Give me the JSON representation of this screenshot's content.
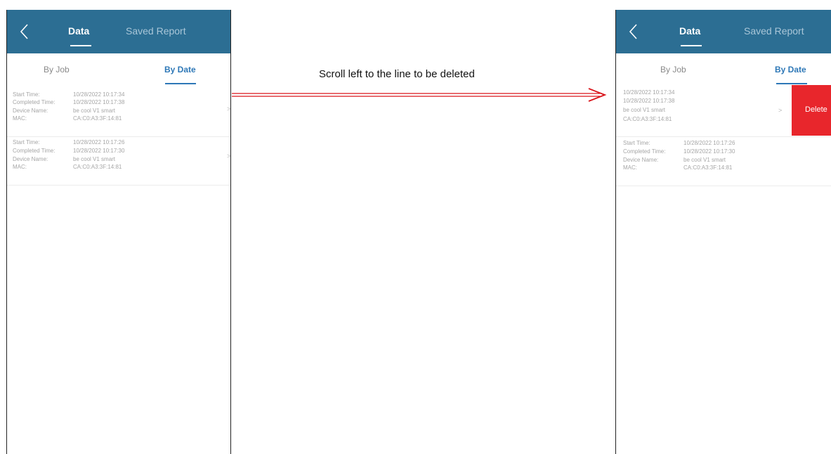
{
  "instruction": "Scroll left to the line to be deleted",
  "colors": {
    "header_bg": "#2c6e93",
    "accent_blue": "#2e78b7",
    "delete_red": "#e8262c",
    "arrow_red": "#d9151b"
  },
  "left_screen": {
    "header": {
      "back_icon": "chevron-left-icon",
      "tab_active": "Data",
      "tab_inactive": "Saved Report"
    },
    "subtabs": {
      "by_job": "By Job",
      "by_date": "By Date"
    },
    "records": [
      {
        "start_label": "Start Time:",
        "start_value": "10/28/2022 10:17:34",
        "completed_label": "Completed Time:",
        "completed_value": "10/28/2022 10:17:38",
        "device_label": "Device Name:",
        "device_value": "be cool V1 smart",
        "mac_label": "MAC:",
        "mac_value": "CA:C0:A3:3F:14:81",
        "chevron": ">"
      },
      {
        "start_label": "Start Time:",
        "start_value": "10/28/2022 10:17:26",
        "completed_label": "Completed Time:",
        "completed_value": "10/28/2022 10:17:30",
        "device_label": "Device Name:",
        "device_value": "be cool V1 smart",
        "mac_label": "MAC:",
        "mac_value": "CA:C0:A3:3F:14:81",
        "chevron": ">"
      }
    ]
  },
  "right_screen": {
    "header": {
      "back_icon": "chevron-left-icon",
      "tab_active": "Data",
      "tab_inactive": "Saved Report"
    },
    "subtabs": {
      "by_job": "By Job",
      "by_date": "By Date"
    },
    "swiped_record": {
      "start_value": "10/28/2022 10:17:34",
      "completed_value": "10/28/2022 10:17:38",
      "device_value": "be cool V1 smart",
      "mac_value": "CA:C0:A3:3F:14:81",
      "chevron": ">",
      "delete_label": "Delete"
    },
    "records": [
      {
        "start_label": "Start Time:",
        "start_value": "10/28/2022 10:17:26",
        "completed_label": "Completed Time:",
        "completed_value": "10/28/2022 10:17:30",
        "device_label": "Device Name:",
        "device_value": "be cool V1 smart",
        "mac_label": "MAC:",
        "mac_value": "CA:C0:A3:3F:14:81"
      }
    ]
  }
}
